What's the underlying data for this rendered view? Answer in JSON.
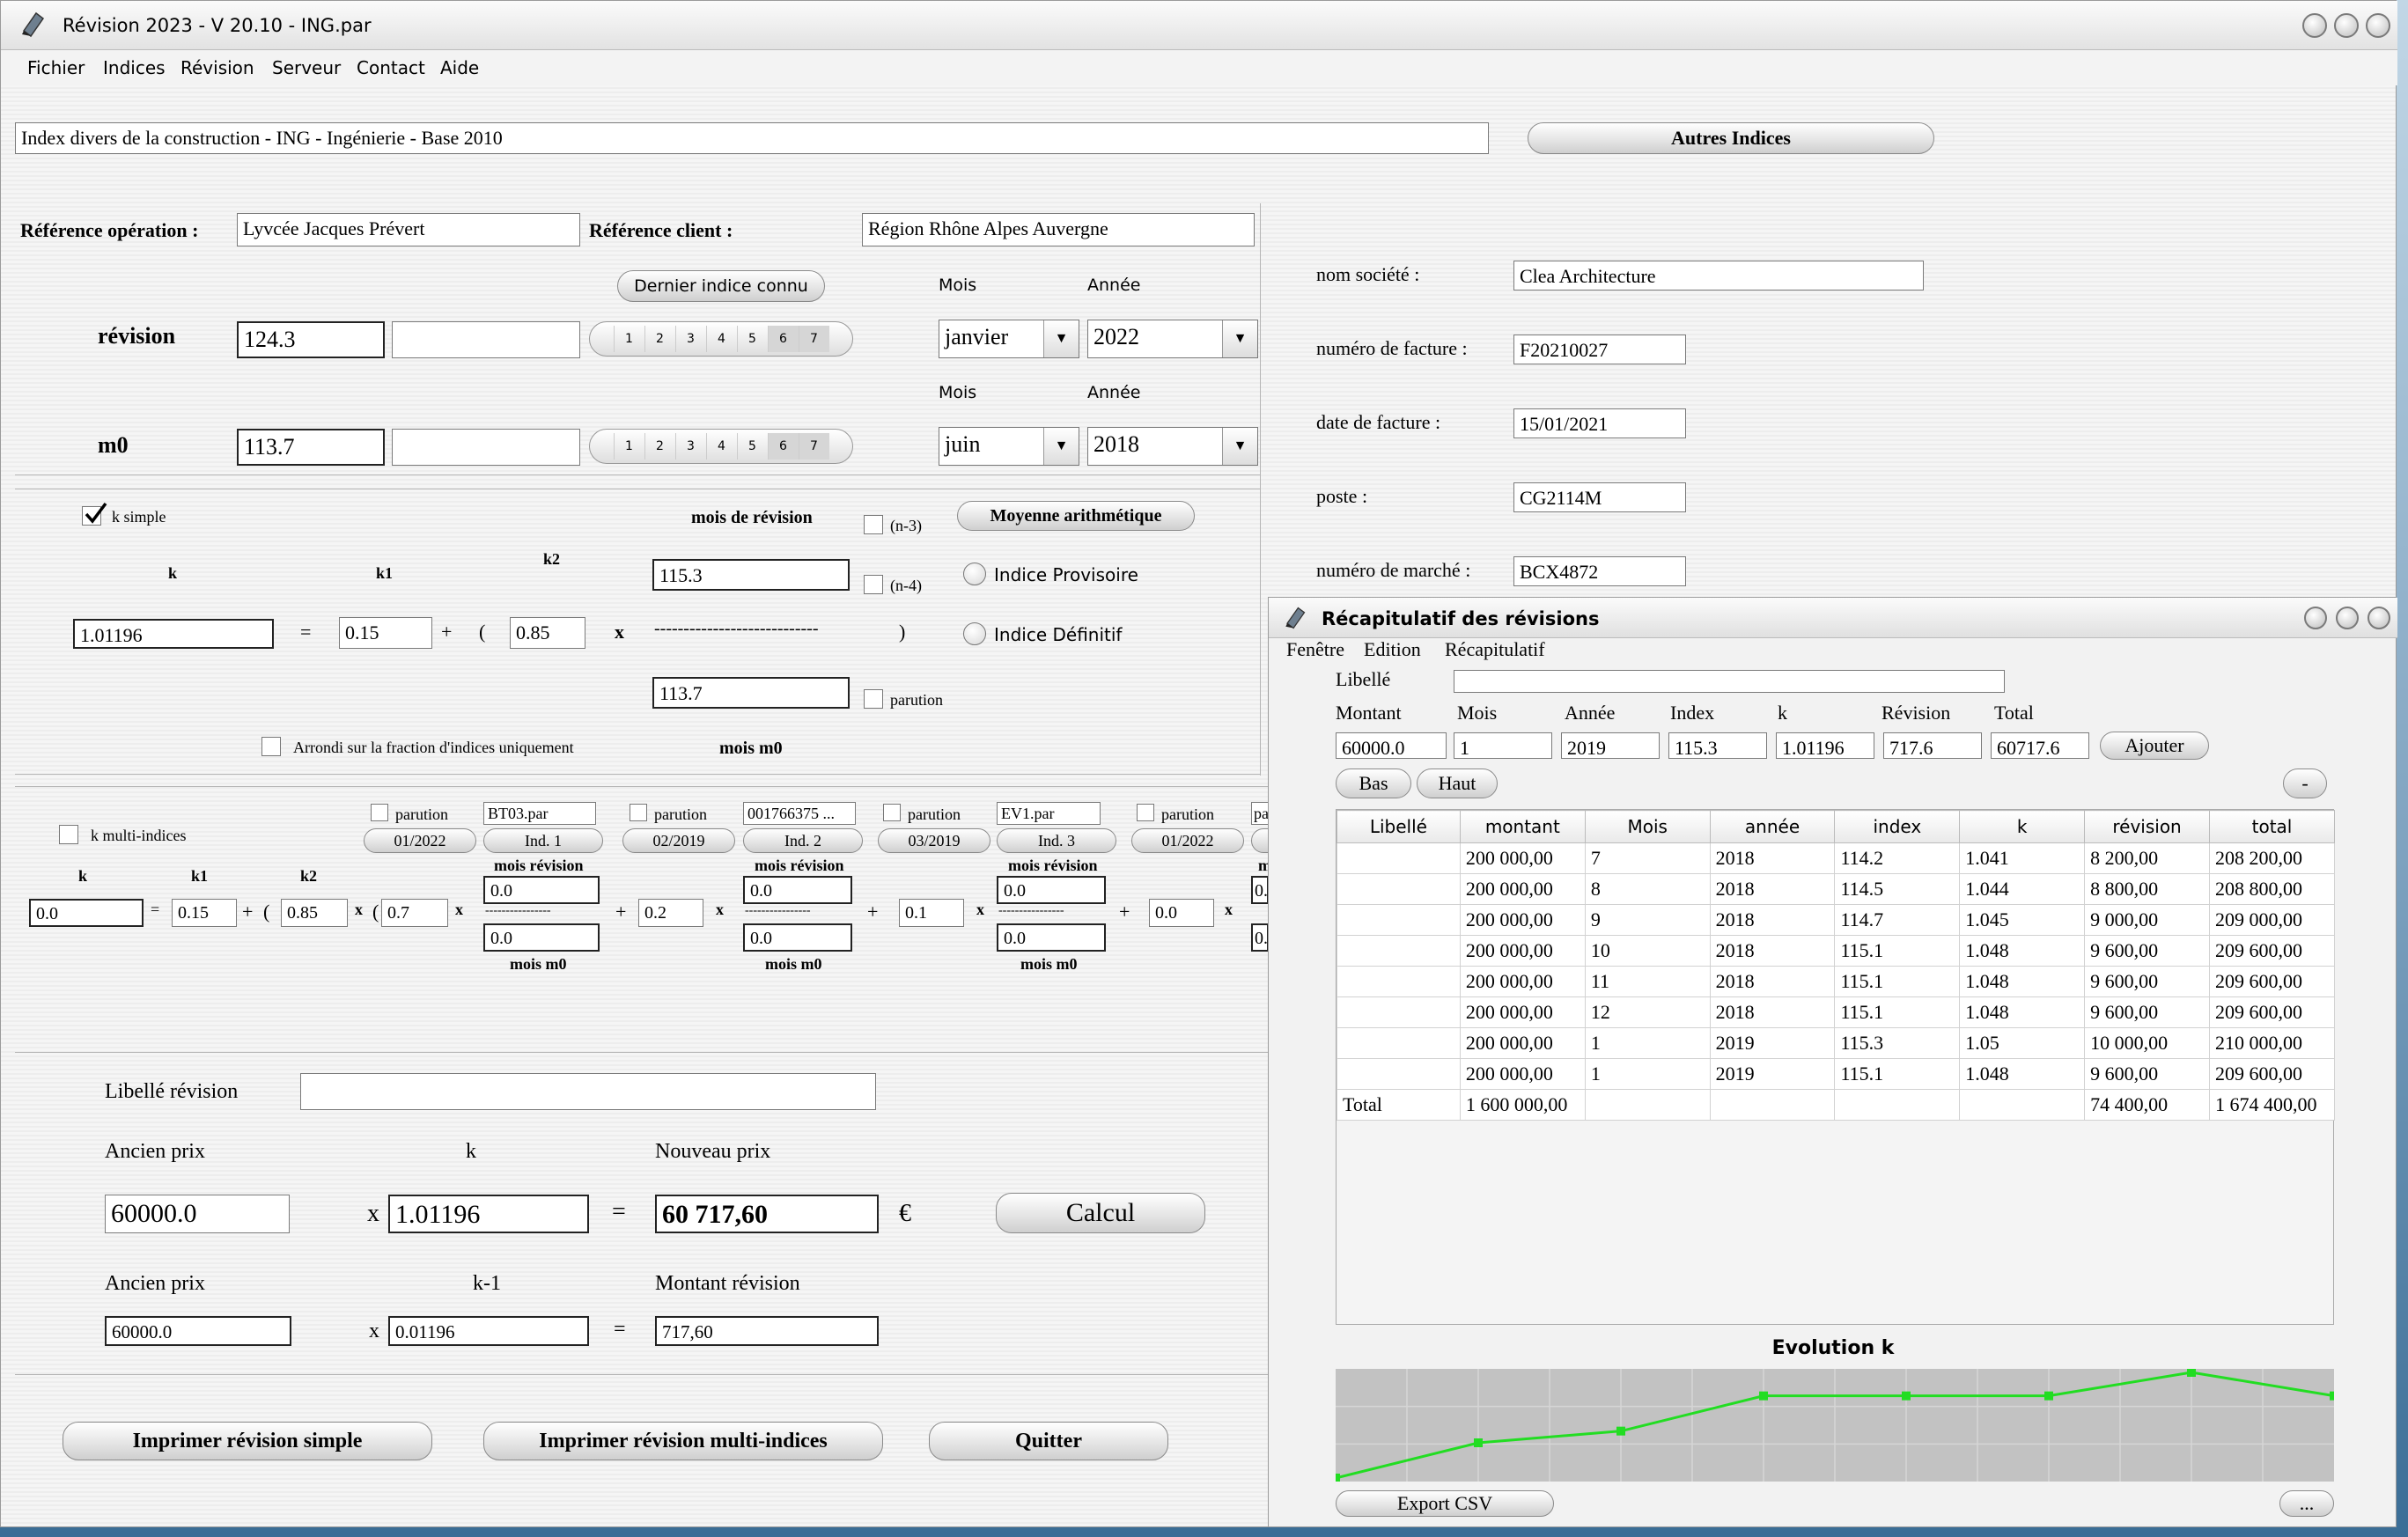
{
  "window": {
    "title": "Révision 2023 - V 20.10 - ING.par"
  },
  "menu": [
    "Fichier",
    "Indices",
    "Révision",
    "Serveur",
    "Contact",
    "Aide"
  ],
  "index_label": "Index divers de la construction - ING - Ingénierie - Base 2010",
  "autres_indices": "Autres Indices",
  "ref_operation_label": "Référence opération :",
  "ref_operation": "Lyvcée Jacques Prévert",
  "ref_client_label": "Référence client :",
  "ref_client": "Région Rhône Alpes Auvergne",
  "dernier_indice": "Dernier indice connu",
  "mois_label": "Mois",
  "annee_label": "Année",
  "idx_numbers": [
    "1",
    "2",
    "3",
    "4",
    "5",
    "6",
    "7"
  ],
  "revision": {
    "label": "révision",
    "value": "124.3",
    "mois": "janvier",
    "annee": "2022"
  },
  "m0": {
    "label": "m0",
    "value": "113.7",
    "mois": "juin",
    "annee": "2018"
  },
  "company": {
    "nom_label": "nom société :",
    "nom": "Clea Architecture",
    "facture_label": "numéro de facture :",
    "facture": "F20210027",
    "date_label": "date de facture :",
    "date": "15/01/2021",
    "poste_label": "poste :",
    "poste": "CG2114M",
    "marche_label": "numéro de marché :",
    "marche": "BCX4872"
  },
  "simple": {
    "k_simple": "k simple",
    "mois_revision": "mois de révision",
    "n3": "(n-3)",
    "n4": "(n-4)",
    "moyenne": "Moyenne arithmétique",
    "provisoire": "Indice Provisoire",
    "definitif": "Indice Définitif",
    "k": "k",
    "k1": "k1",
    "k2": "k2",
    "k_value": "1.01196",
    "k1_value": "0.15",
    "k2_value": "0.85",
    "num": "115.3",
    "den": "113.7",
    "dashes": "----------------------------",
    "parution": "parution",
    "arrondi": "Arrondi sur la fraction d'indices uniquement",
    "mois_m0": "mois m0",
    "eq": "=",
    "plus": "+",
    "open": "(",
    "close": ")",
    "times": "x"
  },
  "multi": {
    "label": "k multi-indices",
    "k": "k",
    "k1": "k1",
    "k2": "k2",
    "k_value": "0.0",
    "k1_value": "0.15",
    "k2_value": "0.85",
    "parution": "parution",
    "mois_revision": "mois révision",
    "mois_m0": "mois m0",
    "indices": [
      {
        "file": "BT03.par",
        "date": "01/2022",
        "btn": "Ind. 1",
        "coef": "0.7",
        "rev": "0.0",
        "m0": "0.0"
      },
      {
        "file": "001766375 ...",
        "date": "02/2019",
        "btn": "Ind. 2",
        "coef": "0.2",
        "rev": "0.0",
        "m0": "0.0"
      },
      {
        "file": "EV1.par",
        "date": "03/2019",
        "btn": "Ind. 3",
        "coef": "0.1",
        "rev": "0.0",
        "m0": "0.0"
      },
      {
        "file": "pa",
        "date": "01/2022",
        "btn": "",
        "coef": "0.0",
        "rev": "0.",
        "m0": "0."
      }
    ],
    "dashes": "----------------",
    "partial_m": "m"
  },
  "calc": {
    "libelle_label": "Libellé révision",
    "libelle": "",
    "ancien_prix": "Ancien prix",
    "k": "k",
    "nouveau_prix": "Nouveau prix",
    "ancien_value": "60000.0",
    "k_value": "1.01196",
    "nouveau_value": "60 717,60",
    "euro": "€",
    "calcul": "Calcul",
    "k1_label": "k-1",
    "montant_label": "Montant révision",
    "ancien_value2": "60000.0",
    "k1_value": "0.01196",
    "montant_value": "717,60",
    "times": "x",
    "eq": "="
  },
  "buttons": {
    "print_simple": "Imprimer révision simple",
    "print_multi": "Imprimer révision multi-indices",
    "quit": "Quitter"
  },
  "recap": {
    "title": "Récapitulatif des révisions",
    "menu": [
      "Fenêtre",
      "Edition",
      "Récapitulatif"
    ],
    "libelle_label": "Libellé",
    "form_labels": [
      "Montant",
      "Mois",
      "Année",
      "Index",
      "k",
      "Révision",
      "Total"
    ],
    "form_values": [
      "60000.0",
      "1",
      "2019",
      "115.3",
      "1.01196",
      "717.6",
      "60717.6"
    ],
    "ajouter": "Ajouter",
    "bas": "Bas",
    "haut": "Haut",
    "minus": "-",
    "columns": [
      "Libellé",
      "montant",
      "Mois",
      "année",
      "index",
      "k",
      "révision",
      "total"
    ],
    "rows": [
      [
        "",
        "200 000,00",
        "7",
        "2018",
        "114.2",
        "1.041",
        "8 200,00",
        "208 200,00"
      ],
      [
        "",
        "200 000,00",
        "8",
        "2018",
        "114.5",
        "1.044",
        "8 800,00",
        "208 800,00"
      ],
      [
        "",
        "200 000,00",
        "9",
        "2018",
        "114.7",
        "1.045",
        "9 000,00",
        "209 000,00"
      ],
      [
        "",
        "200 000,00",
        "10",
        "2018",
        "115.1",
        "1.048",
        "9 600,00",
        "209 600,00"
      ],
      [
        "",
        "200 000,00",
        "11",
        "2018",
        "115.1",
        "1.048",
        "9 600,00",
        "209 600,00"
      ],
      [
        "",
        "200 000,00",
        "12",
        "2018",
        "115.1",
        "1.048",
        "9 600,00",
        "209 600,00"
      ],
      [
        "",
        "200 000,00",
        "1",
        "2019",
        "115.3",
        "1.05",
        "10 000,00",
        "210 000,00"
      ],
      [
        "",
        "200 000,00",
        "1",
        "2019",
        "115.1",
        "1.048",
        "9 600,00",
        "209 600,00"
      ]
    ],
    "total_row": [
      "Total",
      "1 600 000,00",
      "",
      "",
      "",
      "",
      "74 400,00",
      "1 674 400,00"
    ],
    "chart_title": "Evolution k",
    "export": "Export CSV",
    "more": "..."
  },
  "chart_data": {
    "type": "line",
    "title": "Evolution k",
    "x": [
      0,
      1,
      2,
      3,
      4,
      5,
      6,
      7
    ],
    "values": [
      1.041,
      1.044,
      1.045,
      1.048,
      1.048,
      1.048,
      1.05,
      1.048
    ],
    "color": "#22dd22",
    "grid": true
  }
}
